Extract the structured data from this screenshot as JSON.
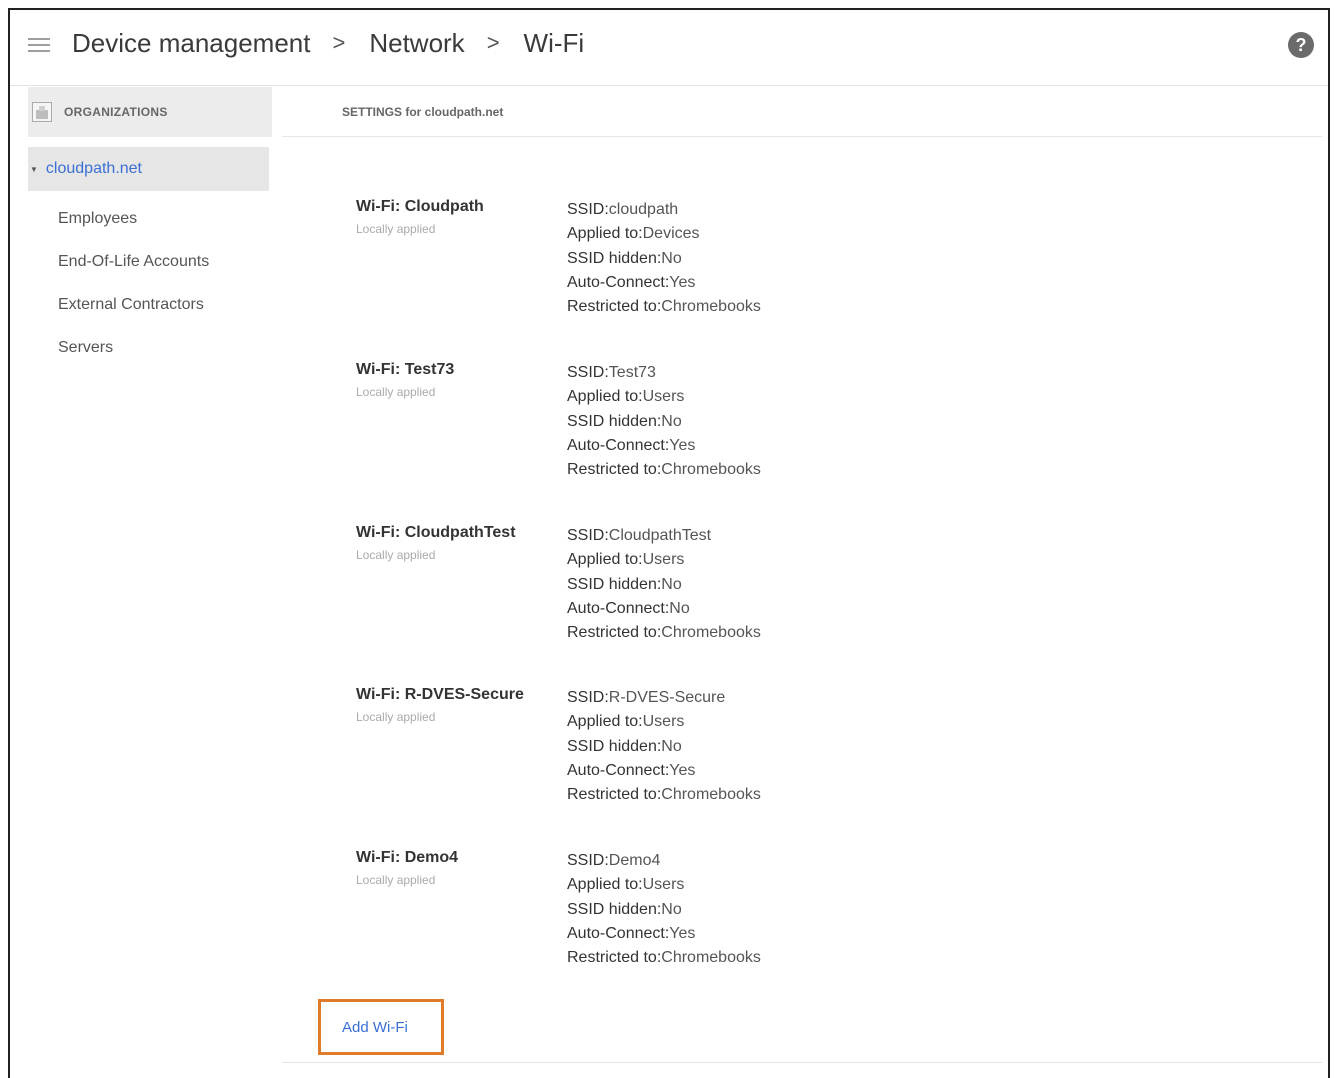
{
  "header": {
    "breadcrumb": [
      "Device management",
      "Network",
      "Wi-Fi"
    ],
    "separator": ">",
    "help_glyph": "?",
    "menu_icon": "hamburger-menu-icon",
    "help_icon": "help-circle-icon"
  },
  "sidebar": {
    "header_label": "ORGANIZATIONS",
    "header_icon": "organization-icon",
    "root": {
      "label": "cloudpath.net",
      "expand_glyph": "▼"
    },
    "children": [
      "Employees",
      "End-Of-Life Accounts",
      "External Contractors",
      "Servers"
    ]
  },
  "main": {
    "settings_title": "SETTINGS for cloudpath.net",
    "networks": [
      {
        "name": "Wi-Fi: Cloudpath",
        "status": "Locally applied",
        "props": [
          {
            "k": "SSID:",
            "v": "cloudpath"
          },
          {
            "k": "Applied to:",
            "v": "Devices"
          },
          {
            "k": "SSID hidden:",
            "v": "No"
          },
          {
            "k": "Auto-Connect:",
            "v": "Yes"
          },
          {
            "k": "Restricted to:",
            "v": "Chromebooks"
          }
        ]
      },
      {
        "name": "Wi-Fi: Test73",
        "status": "Locally applied",
        "props": [
          {
            "k": "SSID:",
            "v": "Test73"
          },
          {
            "k": "Applied to:",
            "v": "Users"
          },
          {
            "k": "SSID hidden:",
            "v": "No"
          },
          {
            "k": "Auto-Connect:",
            "v": "Yes"
          },
          {
            "k": "Restricted to:",
            "v": "Chromebooks"
          }
        ]
      },
      {
        "name": "Wi-Fi: CloudpathTest",
        "status": "Locally applied",
        "props": [
          {
            "k": "SSID:",
            "v": "CloudpathTest"
          },
          {
            "k": "Applied to:",
            "v": "Users"
          },
          {
            "k": "SSID hidden:",
            "v": "No"
          },
          {
            "k": "Auto-Connect:",
            "v": "No"
          },
          {
            "k": "Restricted to:",
            "v": "Chromebooks"
          }
        ]
      },
      {
        "name": "Wi-Fi: R-DVES-Secure",
        "status": "Locally applied",
        "props": [
          {
            "k": "SSID:",
            "v": "R-DVES-Secure"
          },
          {
            "k": "Applied to:",
            "v": "Users"
          },
          {
            "k": "SSID hidden:",
            "v": "No"
          },
          {
            "k": "Auto-Connect:",
            "v": "Yes"
          },
          {
            "k": "Restricted to:",
            "v": "Chromebooks"
          }
        ]
      },
      {
        "name": "Wi-Fi: Demo4",
        "status": "Locally applied",
        "props": [
          {
            "k": "SSID:",
            "v": "Demo4"
          },
          {
            "k": "Applied to:",
            "v": "Users"
          },
          {
            "k": "SSID hidden:",
            "v": "No"
          },
          {
            "k": "Auto-Connect:",
            "v": "Yes"
          },
          {
            "k": "Restricted to:",
            "v": "Chromebooks"
          }
        ]
      }
    ],
    "add_label": "Add Wi-Fi",
    "highlight_color": "#e07b2a",
    "link_color": "#3b6fd4"
  }
}
